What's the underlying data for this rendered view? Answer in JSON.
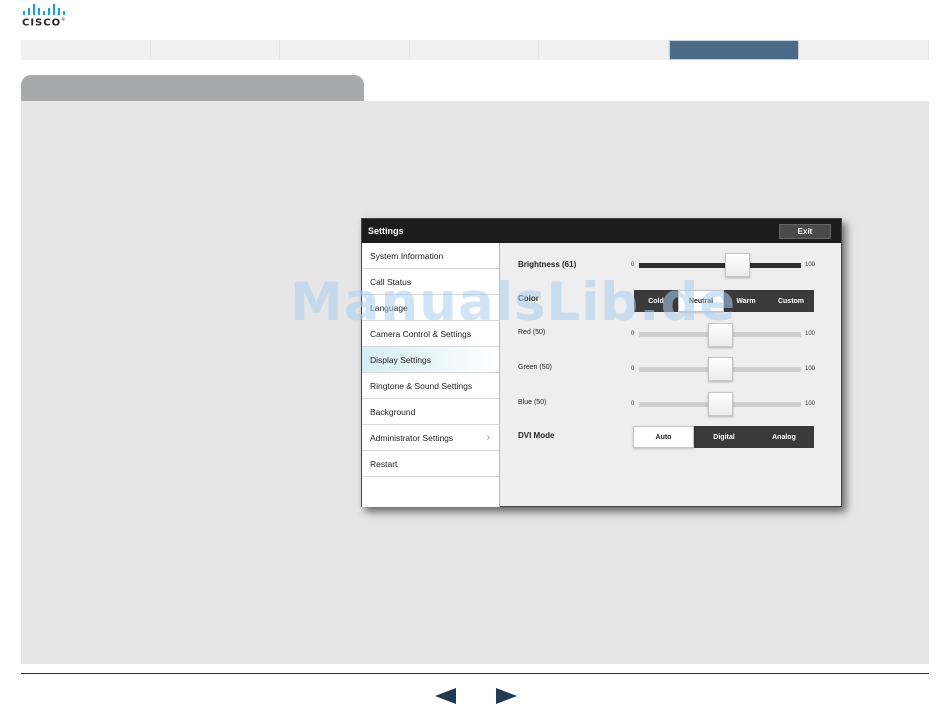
{
  "brand": {
    "logo_text": "CISCO",
    "logo_mark": "®",
    "accent": "#1ba0d7"
  },
  "nav": {
    "tab_count": 7,
    "active_index": 5,
    "active_color": "#4a6b87"
  },
  "settings": {
    "title": "Settings",
    "exit_label": "Exit",
    "menu": [
      {
        "label": "System Information",
        "selected": false,
        "has_chevron": false
      },
      {
        "label": "Call Status",
        "selected": false,
        "has_chevron": false
      },
      {
        "label": "Language",
        "selected": false,
        "has_chevron": false
      },
      {
        "label": "Camera Control & Settings",
        "selected": false,
        "has_chevron": false
      },
      {
        "label": "Display Settings",
        "selected": true,
        "has_chevron": false
      },
      {
        "label": "Ringtone & Sound Settings",
        "selected": false,
        "has_chevron": false
      },
      {
        "label": "Background",
        "selected": false,
        "has_chevron": false
      },
      {
        "label": "Administrator Settings",
        "selected": false,
        "has_chevron": true
      },
      {
        "label": "Restart",
        "selected": false,
        "has_chevron": false
      }
    ],
    "brightness": {
      "label": "Brightness (61)",
      "value": 61,
      "min": "0",
      "max": "100"
    },
    "color": {
      "label": "Color",
      "options": [
        "Cold",
        "Neutral",
        "Warm",
        "Custom"
      ],
      "selected": "Neutral"
    },
    "red": {
      "label": "Red (50)",
      "value": 50,
      "min": "0",
      "max": "100"
    },
    "green": {
      "label": "Green (50)",
      "value": 50,
      "min": "0",
      "max": "100"
    },
    "blue": {
      "label": "Blue (50)",
      "value": 50,
      "min": "0",
      "max": "100"
    },
    "dvi_mode": {
      "label": "DVI Mode",
      "options": [
        "Auto",
        "Digital",
        "Analog"
      ],
      "selected": "Auto"
    }
  },
  "watermark": "ManualsLib.de",
  "footer": {
    "prev_icon": "triangle-left-icon",
    "next_icon": "triangle-right-icon"
  }
}
